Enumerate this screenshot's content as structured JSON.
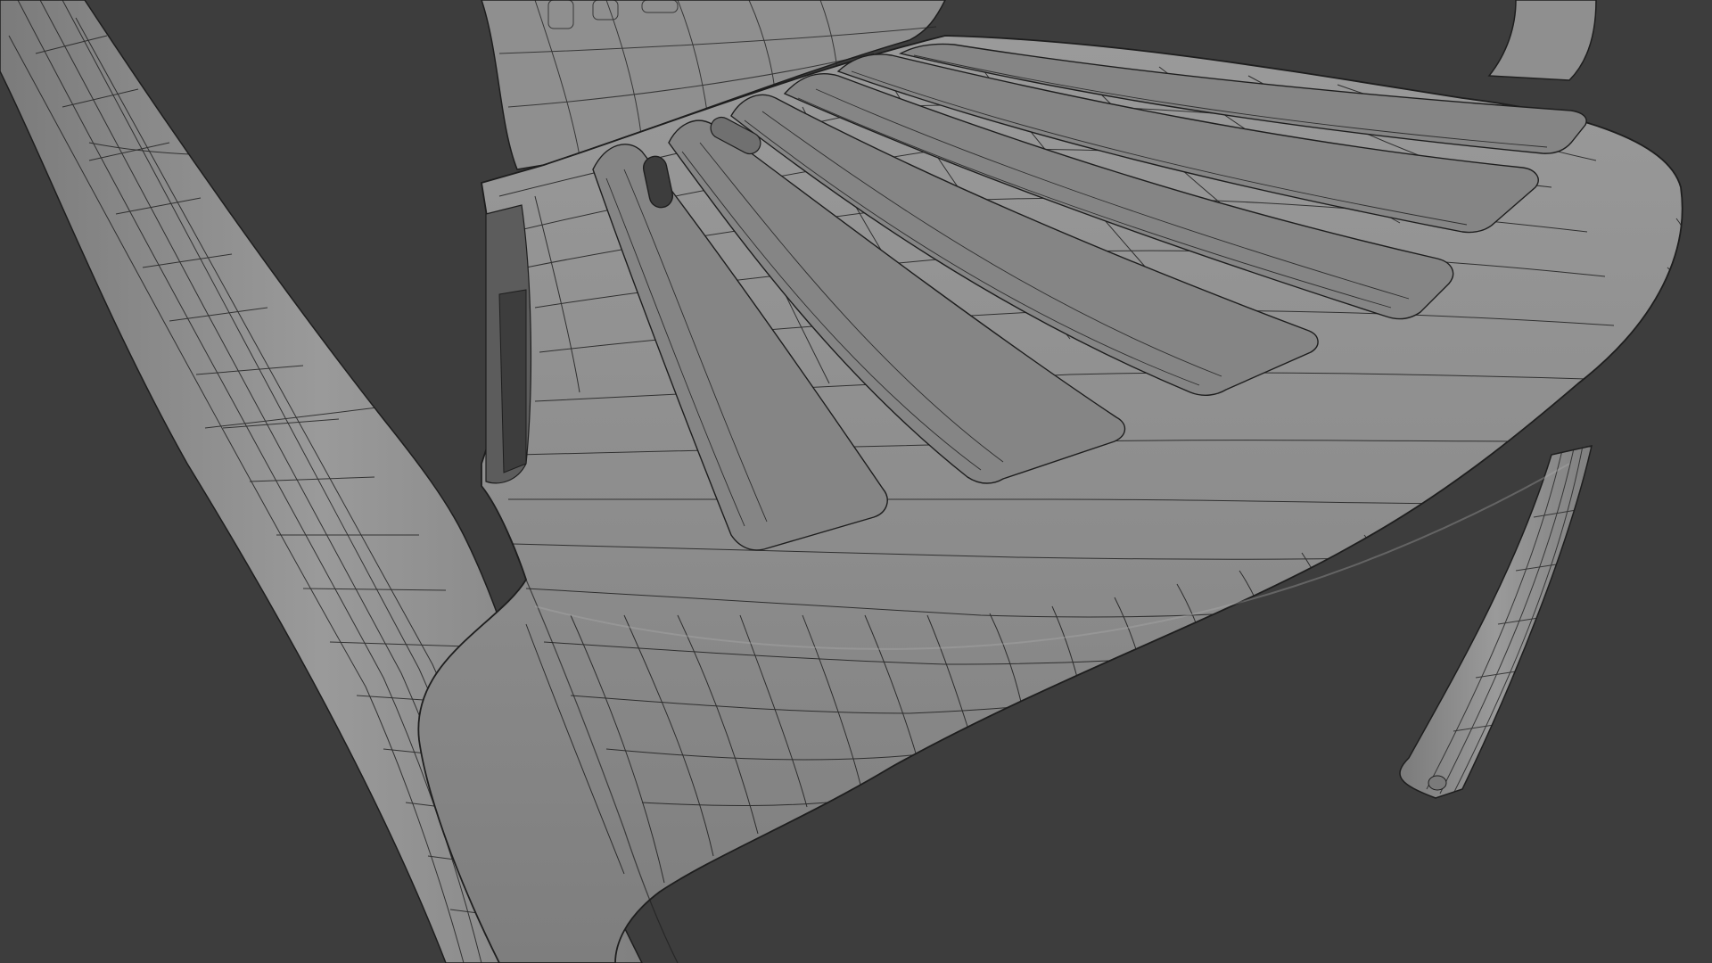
{
  "viewport": {
    "background_color": "#3d3d3d",
    "mesh_surface_color": "#8e8e8e",
    "mesh_wire_color": "#1e1e1e",
    "shading_mode": "solid-wireframe-overlay"
  },
  "scene": {
    "object_type": "plastic-chair-mesh",
    "visible_parts": [
      "left-leg",
      "right-leg",
      "seat",
      "backrest-bottom",
      "seat-slots"
    ]
  }
}
